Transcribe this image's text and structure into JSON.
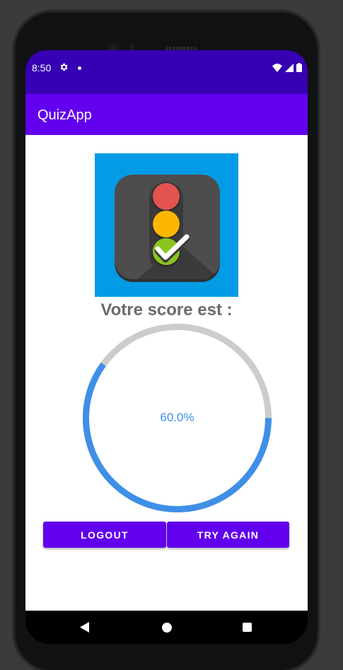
{
  "status_bar": {
    "time": "8:50",
    "icons": [
      "gear-icon",
      "notification-dot-icon",
      "wifi-icon",
      "signal-icon",
      "battery-icon"
    ]
  },
  "app_bar": {
    "title": "QuizApp"
  },
  "main": {
    "logo_icon": "traffic-light-check-icon",
    "score_title": "Votre score est :",
    "progress": {
      "value": 0.6,
      "label": "60.0%",
      "track_color": "#cccccc",
      "fill_color": "#3f8fe8"
    }
  },
  "buttons": {
    "logout_label": "LOGOUT",
    "try_again_label": "TRY AGAIN"
  },
  "nav_bar": {
    "icons": [
      "back-icon",
      "home-icon",
      "recents-icon"
    ]
  },
  "colors": {
    "status_bar": "#3700b3",
    "primary": "#6200ee",
    "logo_bg": "#039be5",
    "score_text": "#6b6b6b"
  }
}
